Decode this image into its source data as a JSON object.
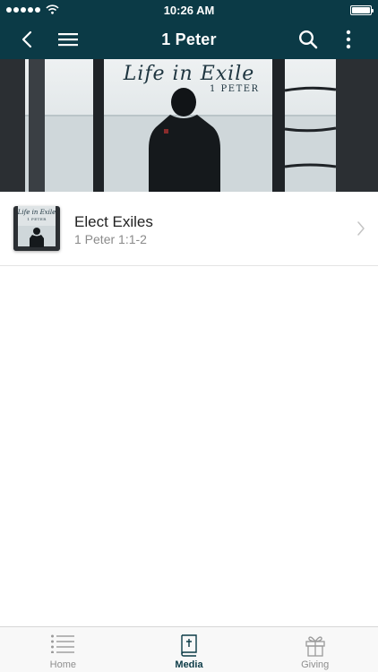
{
  "status_bar": {
    "time": "10:26 AM"
  },
  "nav": {
    "title": "1 Peter",
    "back_icon": "chevron-left-icon",
    "menu_icon": "hamburger-icon",
    "search_icon": "search-icon",
    "more_icon": "more-vertical-icon"
  },
  "banner": {
    "title": "Life in Exile",
    "subtitle": "1 PETER"
  },
  "thumb": {
    "title": "Life in Exile",
    "subtitle": "1 PETER"
  },
  "list": [
    {
      "title": "Elect Exiles",
      "subtitle": "1 Peter 1:1-2"
    }
  ],
  "tabs": [
    {
      "label": "Home",
      "icon": "list-icon",
      "active": false
    },
    {
      "label": "Media",
      "icon": "bible-icon",
      "active": true
    },
    {
      "label": "Giving",
      "icon": "gift-icon",
      "active": false
    }
  ],
  "colors": {
    "primary": "#0b3a46",
    "inactive": "#8e8e8e"
  }
}
